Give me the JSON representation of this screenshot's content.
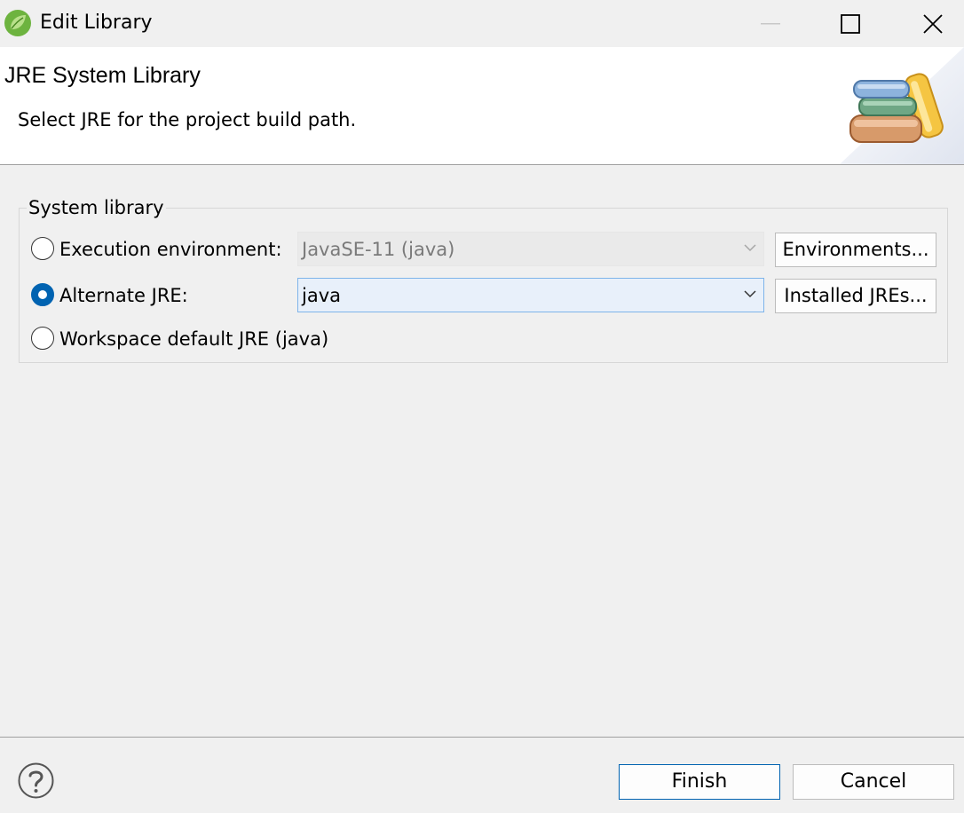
{
  "window": {
    "title": "Edit Library",
    "app_icon": "spring-leaf-icon",
    "controls": [
      "minimize-icon",
      "maximize-icon",
      "close-icon"
    ]
  },
  "banner": {
    "title": "JRE System Library",
    "description": "Select JRE for the project build path.",
    "image": "library-books-icon"
  },
  "group": {
    "label": "System library",
    "options": [
      {
        "label": "Execution environment:",
        "selected": false,
        "combo_value": "JavaSE-11 (java)",
        "combo_enabled": false,
        "button": "Environments..."
      },
      {
        "label": "Alternate JRE:",
        "selected": true,
        "combo_value": "java",
        "combo_enabled": true,
        "button": "Installed JREs..."
      },
      {
        "label": "Workspace default JRE (java)",
        "selected": false
      }
    ]
  },
  "footer": {
    "help_icon": "help-icon",
    "finish": "Finish",
    "cancel": "Cancel"
  },
  "colors": {
    "accent": "#0063b1",
    "combo_focus_bg": "#e8f0fa",
    "combo_focus_border": "#7eb4ea",
    "dialog_bg": "#f0f0f0"
  }
}
